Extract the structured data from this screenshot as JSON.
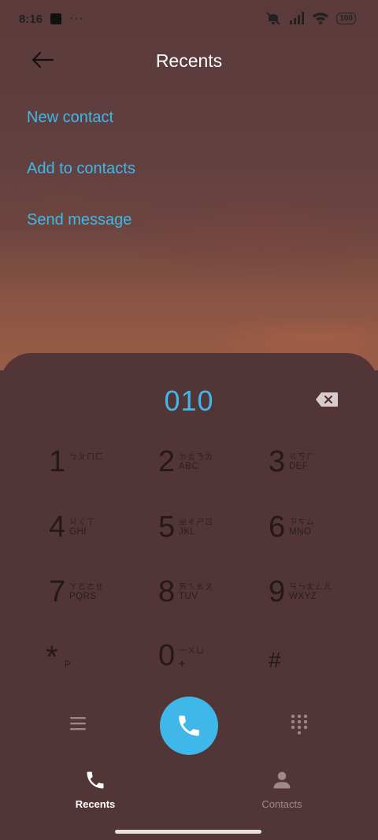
{
  "status": {
    "time": "8:16",
    "more": "···",
    "battery": "100",
    "icons": [
      "dnd-off-icon",
      "signal-icon",
      "wifi-icon",
      "battery-icon"
    ]
  },
  "header": {
    "title": "Recents",
    "back_icon": "back-arrow-icon"
  },
  "actions": {
    "new_contact": "New contact",
    "add_to_contacts": "Add to contacts",
    "send_message": "Send message"
  },
  "dialer": {
    "number": "010",
    "backspace_icon": "backspace-icon",
    "keys": [
      {
        "digit": "1",
        "zh": "ㄅㄆㄇㄈ",
        "en": ""
      },
      {
        "digit": "2",
        "zh": "ㄉㄊㄋㄌ",
        "en": "ABC"
      },
      {
        "digit": "3",
        "zh": "ㄍㄎㄏ",
        "en": "DEF"
      },
      {
        "digit": "4",
        "zh": "ㄐㄑㄒ",
        "en": "GHI"
      },
      {
        "digit": "5",
        "zh": "ㄓㄔㄕㄖ",
        "en": "JKL"
      },
      {
        "digit": "6",
        "zh": "ㄗㄘㄙ",
        "en": "MNO"
      },
      {
        "digit": "7",
        "zh": "ㄚㄛㄜㄝ",
        "en": "PQRS"
      },
      {
        "digit": "8",
        "zh": "ㄞㄟㄠㄡ",
        "en": "TUV"
      },
      {
        "digit": "9",
        "zh": "ㄢㄣㄤㄥㄦ",
        "en": "WXYZ"
      },
      {
        "digit": "*",
        "zh": "",
        "en": "P"
      },
      {
        "digit": "0",
        "zh": "一ㄨㄩ",
        "en": "+"
      },
      {
        "digit": "#",
        "zh": "",
        "en": ""
      }
    ]
  },
  "controls": {
    "menu_icon": "menu-icon",
    "call_icon": "phone-icon",
    "dialpad_icon": "dialpad-icon"
  },
  "nav": {
    "recents": "Recents",
    "contacts": "Contacts"
  },
  "colors": {
    "accent": "#3fb8e9",
    "sheet": "#513537",
    "key_text": "#241819"
  }
}
